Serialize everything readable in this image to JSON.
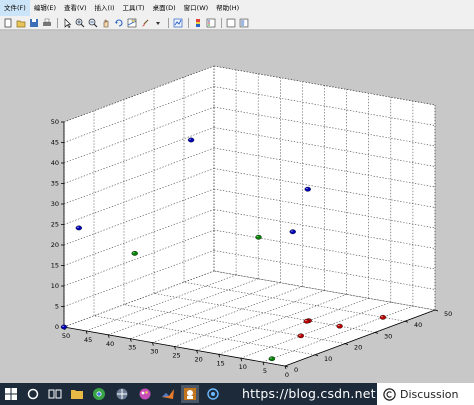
{
  "menubar": {
    "items": [
      {
        "label": "文件(F)"
      },
      {
        "label": "编辑(E)"
      },
      {
        "label": "查看(V)"
      },
      {
        "label": "插入(I)"
      },
      {
        "label": "工具(T)"
      },
      {
        "label": "桌面(D)"
      },
      {
        "label": "窗口(W)"
      },
      {
        "label": "帮助(H)"
      }
    ]
  },
  "toolbar": {
    "groups": [
      [
        "new-figure-icon",
        "open-file-icon",
        "save-icon",
        "print-icon"
      ],
      [
        "pointer-icon",
        "zoom-in-icon",
        "zoom-out-icon",
        "pan-icon",
        "rotate-3d-icon",
        "data-cursor-icon",
        "brush-icon",
        "dropdown-arrow-icon"
      ],
      [
        "link-plot-icon"
      ],
      [
        "colorbar-icon",
        "legend-icon"
      ],
      [
        "hide-plot-tools-icon",
        "show-plot-tools-icon"
      ]
    ]
  },
  "chart_data": {
    "type": "scatter3d",
    "title": "",
    "xlabel": "",
    "ylabel": "",
    "zlabel": "",
    "xlim": [
      0,
      50
    ],
    "ylim": [
      0,
      50
    ],
    "zlim": [
      0,
      50
    ],
    "x_ticks": [
      0,
      5,
      10,
      15,
      20,
      25,
      30,
      35,
      40,
      45,
      50
    ],
    "y_ticks": [
      0,
      10,
      20,
      30,
      40,
      50
    ],
    "z_ticks": [
      0,
      5,
      10,
      15,
      20,
      25,
      30,
      35,
      40,
      45,
      50
    ],
    "grid": true,
    "series": [
      {
        "color": "#0000b4",
        "points": [
          [
            48,
            2,
            24
          ],
          [
            45,
            35,
            37
          ],
          [
            22,
            40,
            28
          ],
          [
            22,
            35,
            19
          ],
          [
            50,
            0,
            0
          ]
        ]
      },
      {
        "color": "#008000",
        "points": [
          [
            34,
            0,
            21
          ],
          [
            25,
            28,
            19
          ],
          [
            5,
            3,
            0
          ]
        ]
      },
      {
        "color": "#b40000",
        "points": [
          [
            10,
            20,
            0
          ],
          [
            15,
            30,
            0
          ],
          [
            10,
            22,
            3
          ],
          [
            8,
            30,
            0
          ],
          [
            5,
            40,
            0
          ]
        ]
      }
    ]
  },
  "taskbar": {
    "icons": [
      "windows-start-icon",
      "search-circle-icon",
      "task-view-icon",
      "file-explorer-icon",
      "chrome-icon",
      "network-icon",
      "paint-icon",
      "matlab-icon",
      "photo-icon",
      "capture-icon"
    ]
  },
  "watermark": {
    "text": "https://blog.csdn.net"
  },
  "discussion": {
    "label": "Discussion"
  }
}
